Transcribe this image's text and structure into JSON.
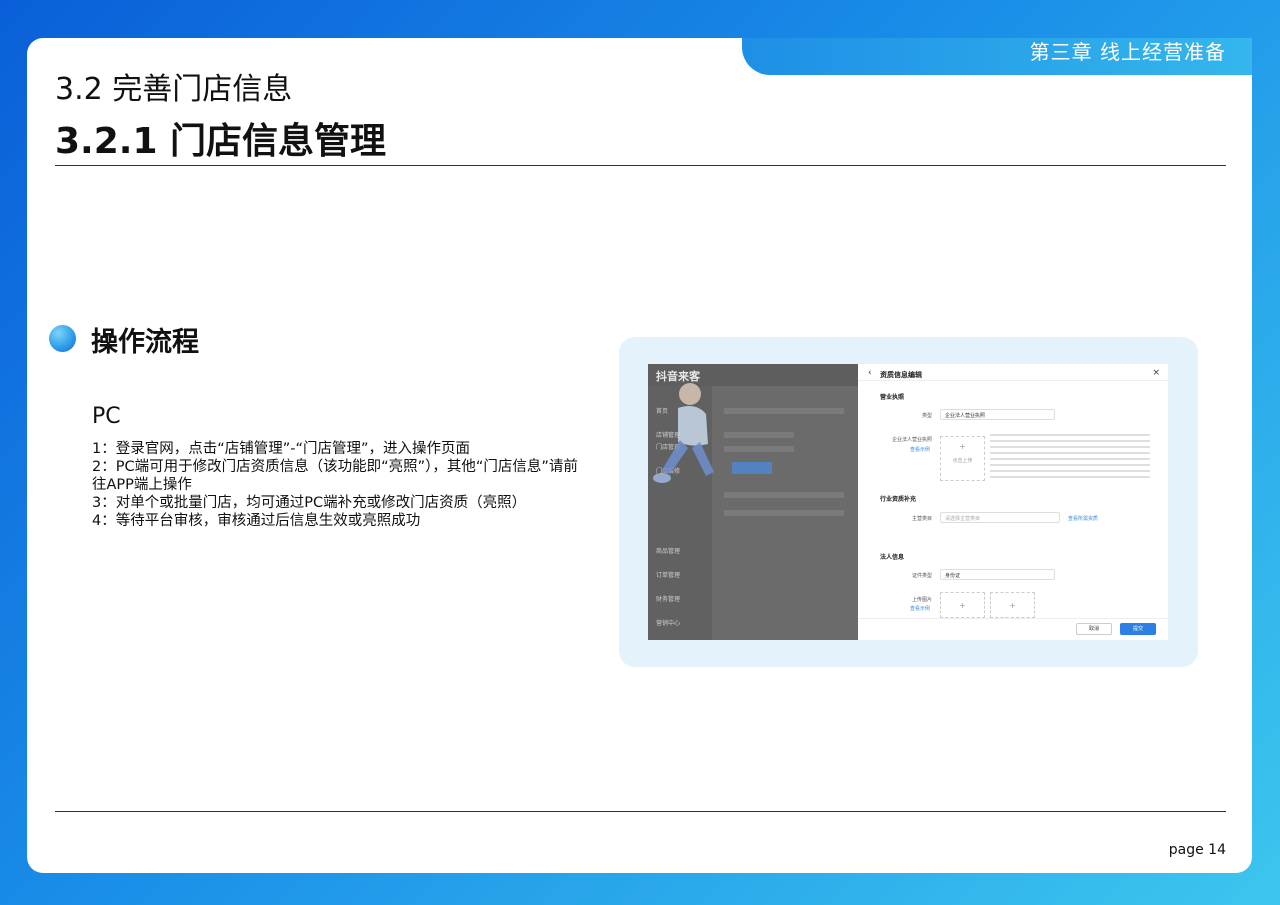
{
  "header": {
    "chapter": "第三章 线上经营准备",
    "section_title": "3.2 完善门店信息",
    "subsection_title": "3.2.1 门店信息管理"
  },
  "content": {
    "flow_heading": "操作流程",
    "platform": "PC",
    "steps": [
      "1：登录官网，点击“店铺管理”-“门店管理”，进入操作页面",
      "2：PC端可用于修改门店资质信息（该功能即“亮照”），其他“门店信息”请前往APP端上操作",
      "3：对单个或批量门店，均可通过PC端补充或修改门店资质（亮照）",
      "4：等待平台审核，审核通过后信息生效或亮照成功"
    ]
  },
  "screenshot": {
    "logo": "抖音来客",
    "sidebar": [
      "首页",
      "店铺管理",
      "门店管理",
      "门店装修",
      "商品管理",
      "订单管理",
      "财务管理",
      "营销中心"
    ],
    "drawer": {
      "back_icon": "chevron-left-icon",
      "title": "资质信息编辑",
      "close_icon": "close-icon",
      "sec_license": "营业执照",
      "lbl_type": "类型",
      "val_type": "企业法人营业执照",
      "lbl_license": "企业法人营业执照",
      "link_example": "查看示例",
      "upload_label": "点击上传",
      "sec_industry": "行业资质补充",
      "lbl_main_type": "主营类目",
      "ph_main_type": "请选择主营类目",
      "link_industry": "查看所需资质",
      "sec_legal": "法人信息",
      "lbl_id_type": "证件类型",
      "val_id_type": "身份证",
      "lbl_upload_img": "上传图片",
      "cancel": "取消",
      "submit": "提交"
    }
  },
  "footer": {
    "page": "page 14"
  }
}
